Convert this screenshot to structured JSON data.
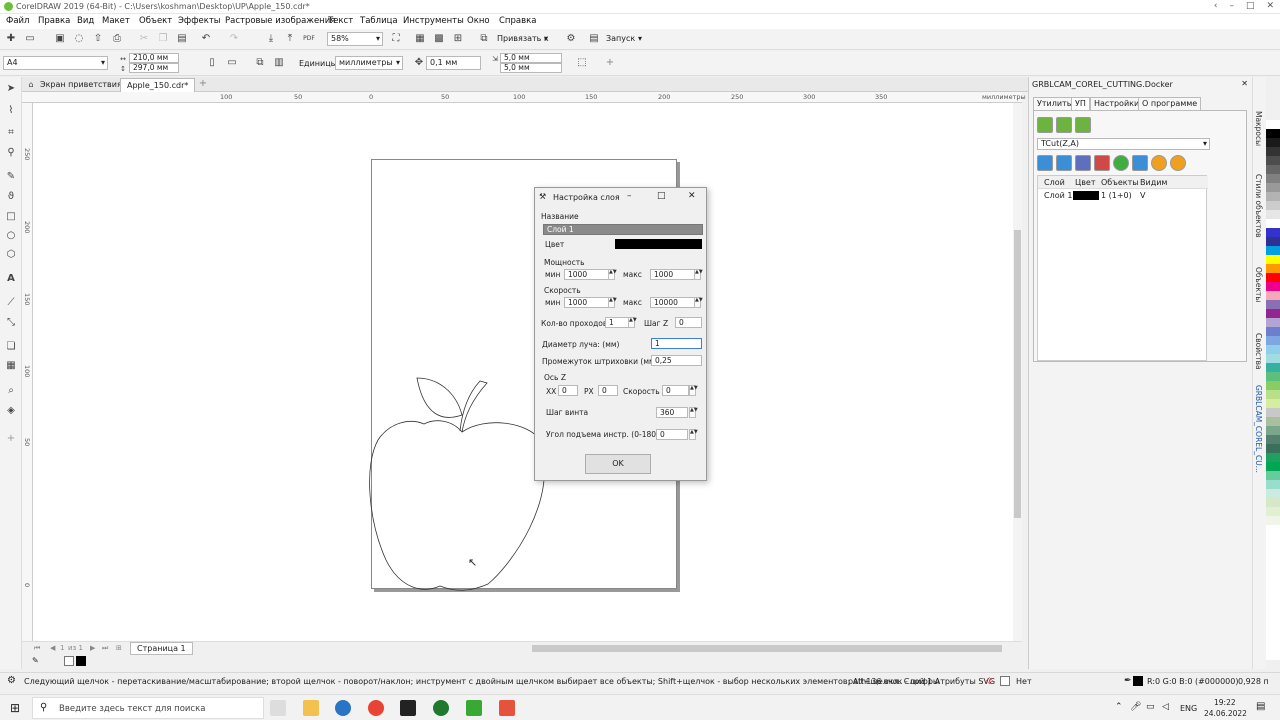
{
  "window": {
    "title": "CorelDRAW 2019 (64-Bit) - C:\\Users\\koshman\\Desktop\\UP\\Apple_150.cdr*",
    "controls": [
      "‹",
      "–",
      "□",
      "✕"
    ]
  },
  "menu": [
    "Файл",
    "Правка",
    "Вид",
    "Макет",
    "Объект",
    "Эффекты",
    "Растровые изображения",
    "Текст",
    "Таблица",
    "Инструменты",
    "Окно",
    "Справка"
  ],
  "toolbar1": {
    "zoom": "58%",
    "snap_label": "Привязать к",
    "launch_label": "Запуск"
  },
  "toolbar2": {
    "page_size": "A4",
    "width": "210,0 мм",
    "height": "297,0 мм",
    "units_label": "Единицы:",
    "units": "миллиметры",
    "nudge": "0,1 мм",
    "dup_x": "5,0 мм",
    "dup_y": "5,0 мм"
  },
  "doc_tabs": [
    "Экран приветствия",
    "Apple_150.cdr*"
  ],
  "ruler": {
    "h": [
      "100",
      "50",
      "0",
      "50",
      "100",
      "150",
      "200",
      "250",
      "300",
      "350"
    ],
    "unit": "миллиметры",
    "v": [
      "250",
      "200",
      "150",
      "100",
      "50",
      "0"
    ]
  },
  "page_nav": {
    "counter": "1",
    "of": "из 1",
    "page_tab": "Страница 1"
  },
  "status": {
    "hint": "Следующий щелчок - перетаскивание/масштабирование; второй щелчок - поворот/наклон; инструмент с двойным щелчком выбирает все объекты; Shift+щелчок - выбор нескольких элементов; Alt+щелчок - цифры",
    "object": "path136 вкл. Слой 1 Атрибуты SVG",
    "fill": "Нет",
    "color": "R:0 G:0 B:0 (#000000)",
    "outline": "0,928 п"
  },
  "taskbar": {
    "search_placeholder": "Введите здесь текст для поиска",
    "lang": "ENG",
    "time": "19:22",
    "date": "24.06.2022"
  },
  "docker": {
    "title": "GRBLCAM_COREL_CUTTING.Docker",
    "tabs": [
      "Утилиты",
      "УП",
      "Настройки",
      "О программе"
    ],
    "mode": "TCut(Z,A)",
    "columns": [
      "Слой",
      "Цвет",
      "Объекты",
      "Видим"
    ],
    "rows": [
      {
        "layer": "Слой 1",
        "objects": "1 (1+0)",
        "visible": "V"
      }
    ]
  },
  "side_tabs": [
    "Макросы",
    "Стили объектов",
    "Объекты",
    "Свойства",
    "GRBLCAM_COREL_CU..."
  ],
  "dialog": {
    "title": "Настройка слоя",
    "name_label": "Название",
    "name_value": "Слой 1",
    "color_label": "Цвет",
    "power_label": "Мощность",
    "min_label": "мин",
    "max_label": "макс",
    "power_min": "1000",
    "power_max": "1000",
    "speed_label": "Скорость",
    "speed_min": "1000",
    "speed_max": "10000",
    "passes_label": "Кол-во проходов",
    "passes": "1",
    "stepz_label": "Шаг Z",
    "stepz": "0",
    "beam_label": "Диаметр луча: (мм)",
    "beam": "1",
    "hatch_label": "Промежуток штриховки (мм)",
    "hatch": "0,25",
    "axisz_label": "Ось Z",
    "xx_label": "XX",
    "xx": "0",
    "px_label": "PX",
    "px": "0",
    "speed2_label": "Скорость",
    "speed2": "0",
    "screw_label": "Шаг винта",
    "screw": "360",
    "angle_label": "Угол подъема инстр. (0-180)",
    "angle": "0",
    "ok": "OK"
  },
  "palette": [
    "#ffffff",
    "#000000",
    "#1a1a1a",
    "#333333",
    "#4d4d4d",
    "#666666",
    "#808080",
    "#999999",
    "#b3b3b3",
    "#cccccc",
    "#e6e6e6",
    "#ffffff",
    "#3333cc",
    "#2e3192",
    "#00a0e3",
    "#ffff00",
    "#ff9900",
    "#ff0000",
    "#ec008c",
    "#f7a8b8",
    "#8b6fb5",
    "#92278f",
    "#b3a4d3",
    "#6d7fcc",
    "#7ea6e0",
    "#8fd0e8",
    "#a0dce0",
    "#38b0a0",
    "#5cbf7d",
    "#88cc66",
    "#b8e08a",
    "#d6eca0",
    "#c8c8c8",
    "#a9c0a0",
    "#7aa68c",
    "#557f6e",
    "#3a6f5c",
    "#20a060",
    "#00a651",
    "#66cc99",
    "#99ddcc",
    "#ccebe0",
    "#d6e8c8",
    "#e0f0d0",
    "#f0f5e8",
    "#ffffff"
  ]
}
